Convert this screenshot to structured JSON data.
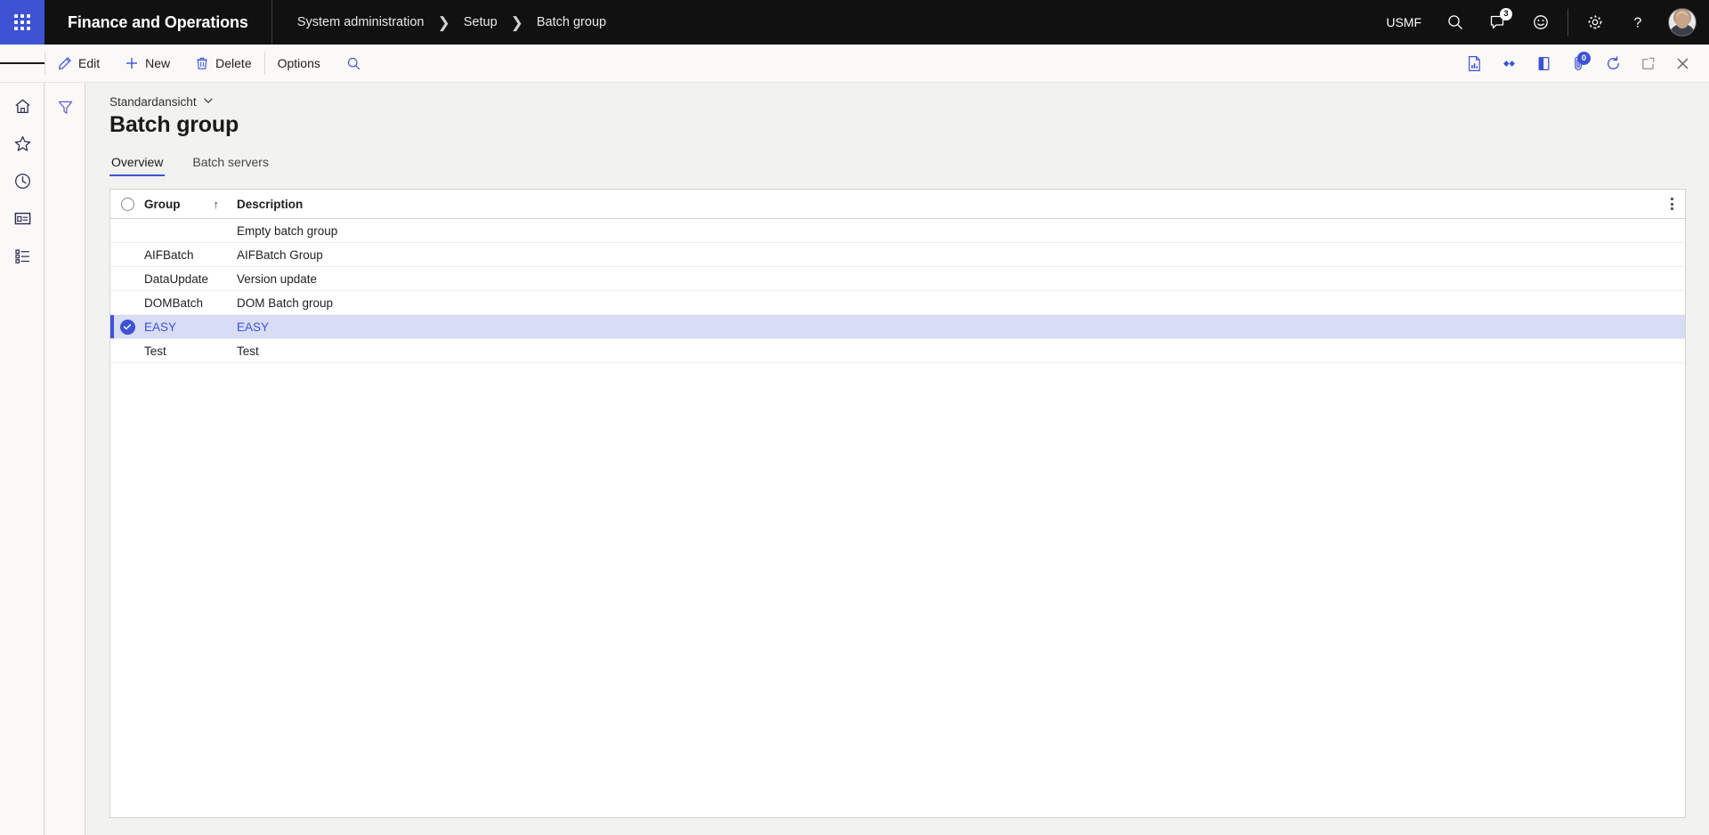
{
  "topbar": {
    "app_launcher_name": "waffle-icon",
    "app_title": "Finance and Operations",
    "breadcrumb": [
      "System administration",
      "Setup",
      "Batch group"
    ],
    "company": "USMF",
    "search_label": "Search",
    "notifications_label": "Notifications",
    "notifications_count": "3",
    "feedback_label": "Feedback",
    "settings_label": "Settings",
    "help_label": "Help",
    "avatar_label": "User profile"
  },
  "commandbar": {
    "menu_label": "Show navigation pane",
    "buttons": [
      {
        "label": "Edit",
        "icon": "pencil-icon"
      },
      {
        "label": "New",
        "icon": "plus-icon"
      },
      {
        "label": "Delete",
        "icon": "trash-icon"
      },
      {
        "label": "Options",
        "icon": ""
      }
    ],
    "search_label": "Search",
    "right_icons": [
      {
        "name": "report-icon",
        "label": "Open in Excel"
      },
      {
        "name": "office-apps-icon",
        "label": "Office apps"
      },
      {
        "name": "panel-icon",
        "label": "Open in new window"
      },
      {
        "name": "attachments-icon",
        "label": "Attachments",
        "badge": "0"
      },
      {
        "name": "refresh-icon",
        "label": "Refresh"
      },
      {
        "name": "popout-icon",
        "label": "Pop out"
      },
      {
        "name": "close-icon",
        "label": "Close"
      }
    ]
  },
  "navrail": {
    "items": [
      {
        "name": "home-icon",
        "label": "Home"
      },
      {
        "name": "star-icon",
        "label": "Favorites"
      },
      {
        "name": "clock-icon",
        "label": "Recent"
      },
      {
        "name": "workspaces-icon",
        "label": "Workspaces"
      },
      {
        "name": "modules-icon",
        "label": "Modules"
      }
    ]
  },
  "filterrail": {
    "filter_label": "Show filter pane",
    "icon": "filter-icon"
  },
  "page": {
    "view_selector": "Standardansicht",
    "title": "Batch group",
    "tabs": [
      {
        "label": "Overview",
        "active": true
      },
      {
        "label": "Batch servers",
        "active": false
      }
    ]
  },
  "grid": {
    "select_all_label": "Select all",
    "options_label": "Grid options",
    "columns": [
      {
        "key": "group",
        "label": "Group",
        "sort": "↑"
      },
      {
        "key": "description",
        "label": "Description",
        "sort": ""
      }
    ],
    "rows": [
      {
        "group": "",
        "description": "Empty batch group",
        "selected": false
      },
      {
        "group": "AIFBatch",
        "description": "AIFBatch Group",
        "selected": false
      },
      {
        "group": "DataUpdate",
        "description": "Version update",
        "selected": false
      },
      {
        "group": "DOMBatch",
        "description": "DOM Batch group",
        "selected": false
      },
      {
        "group": "EASY",
        "description": "EASY",
        "selected": true
      },
      {
        "group": "Test",
        "description": "Test",
        "selected": false
      }
    ]
  },
  "colors": {
    "accent": "#3d53d4",
    "topbar_bg": "#111111",
    "selected_row_bg": "#d8dcf5",
    "page_bg": "#f2f2f1",
    "chrome_bg": "#faf9f8"
  }
}
